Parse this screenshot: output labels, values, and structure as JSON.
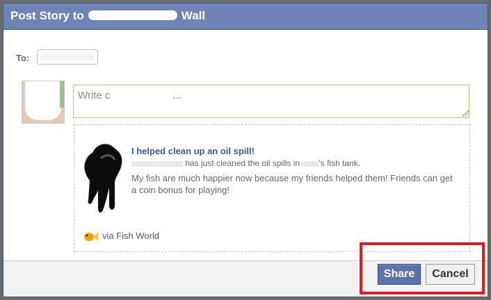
{
  "dialog": {
    "title_prefix": "Post Story to",
    "title_suffix": "Wall"
  },
  "to": {
    "label": "To:"
  },
  "message": {
    "placeholder_start": "Write c",
    "placeholder_end": "..."
  },
  "story": {
    "title": "I helped clean up an oil spill!",
    "subtitle_mid": "has just cleaned the oil spills in",
    "subtitle_end": "'s fish tank.",
    "description": "My fish are much happier now because my friends helped them! Friends can get a coin bonus for playing!",
    "via": "via Fish World"
  },
  "buttons": {
    "share": "Share",
    "cancel": "Cancel"
  },
  "colors": {
    "header": "#6d84b4",
    "share_button": "#5b74a8",
    "highlight": "#e01b1b",
    "title_link": "#3b5998"
  }
}
